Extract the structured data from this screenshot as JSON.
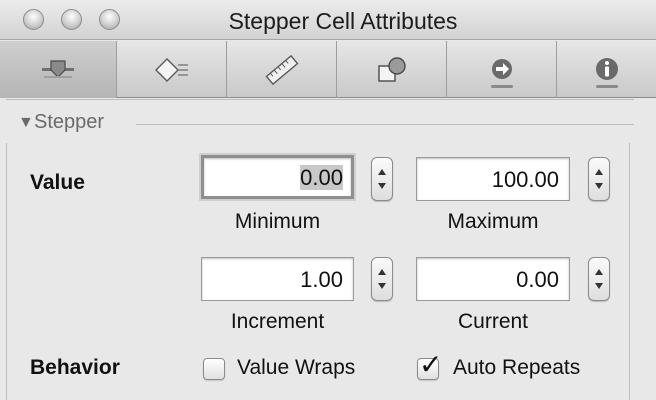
{
  "window": {
    "title": "Stepper Cell Attributes"
  },
  "toolbar": {
    "tabs": [
      {
        "icon": "attributes-slider-icon",
        "selected": true
      },
      {
        "icon": "effects-diamond-icon",
        "selected": false
      },
      {
        "icon": "size-ruler-icon",
        "selected": false
      },
      {
        "icon": "bindings-shapes-icon",
        "selected": false
      },
      {
        "icon": "connections-arrow-icon",
        "selected": false
      },
      {
        "icon": "identity-info-icon",
        "selected": false
      }
    ]
  },
  "section": {
    "toggle": "▼",
    "title": "Stepper"
  },
  "value_row": {
    "label": "Value",
    "minimum": {
      "value": "0.00",
      "caption": "Minimum"
    },
    "maximum": {
      "value": "100.00",
      "caption": "Maximum"
    },
    "increment": {
      "value": "1.00",
      "caption": "Increment"
    },
    "current": {
      "value": "0.00",
      "caption": "Current"
    }
  },
  "behavior_row": {
    "label": "Behavior",
    "value_wraps": {
      "label": "Value Wraps",
      "checked": false
    },
    "auto_repeats": {
      "label": "Auto Repeats",
      "checked": true,
      "mark": "✓"
    }
  }
}
